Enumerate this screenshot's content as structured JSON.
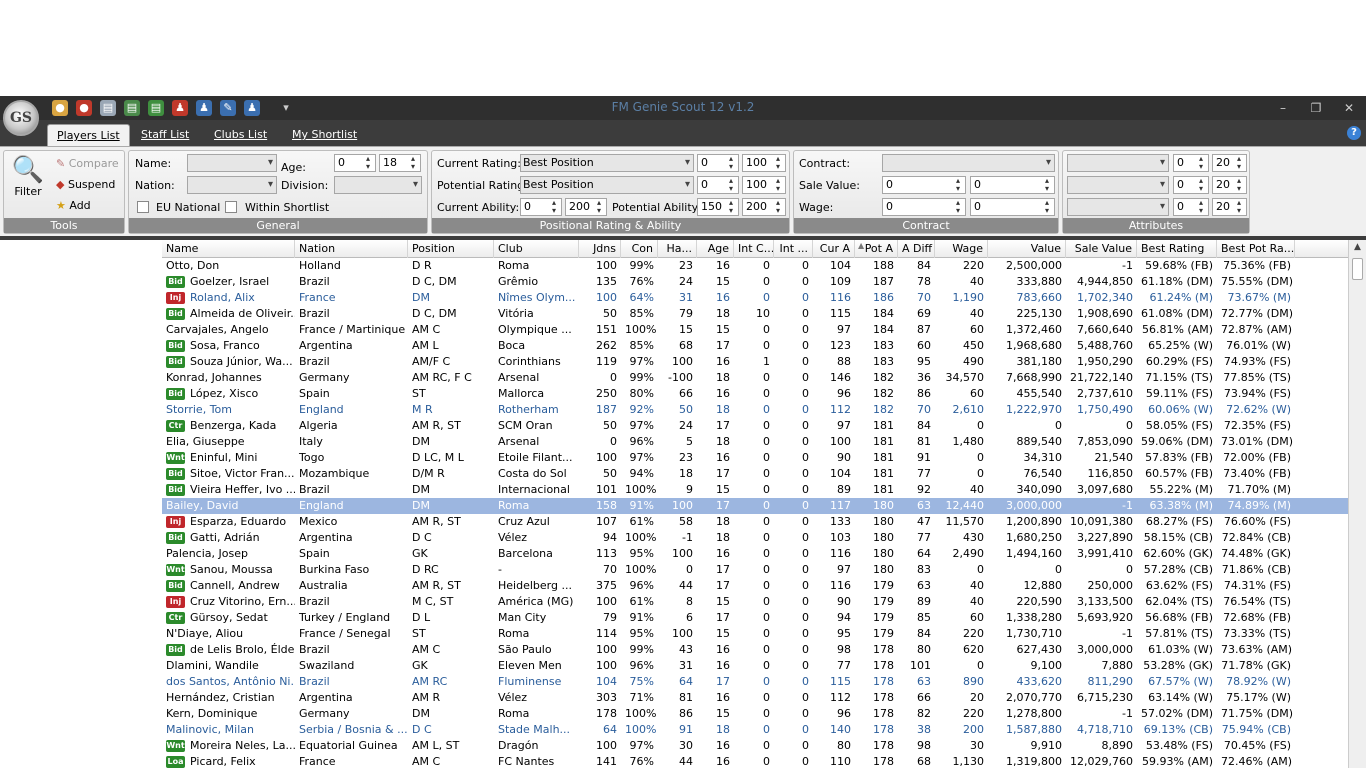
{
  "app": {
    "title": "FM Genie Scout 12 v1.2"
  },
  "tabs": [
    {
      "label": "Players List",
      "active": true
    },
    {
      "label": "Staff List"
    },
    {
      "label": "Clubs List"
    },
    {
      "label": "My Shortlist"
    }
  ],
  "tools": {
    "filter": "Filter",
    "compare": "Compare",
    "suspend": "Suspend",
    "add": "Add",
    "caption": "Tools"
  },
  "general": {
    "name_label": "Name:",
    "nation_label": "Nation:",
    "age_label": "Age:",
    "division_label": "Division:",
    "age_min": "0",
    "age_max": "18",
    "eu_national": "EU National",
    "within_shortlist": "Within Shortlist",
    "caption": "General"
  },
  "positional": {
    "current_rating_label": "Current Rating:",
    "current_rating_value": "Best Position",
    "cr_min": "0",
    "cr_max": "100",
    "potential_rating_label": "Potential Rating:",
    "potential_rating_value": "Best Position",
    "pr_min": "0",
    "pr_max": "100",
    "current_ability_label": "Current Ability:",
    "ca_min": "0",
    "ca_max": "200",
    "potential_ability_label": "Potential Ability:",
    "pa_min": "150",
    "pa_max": "200",
    "caption": "Positional Rating & Ability"
  },
  "contract": {
    "contract_label": "Contract:",
    "sale_value_label": "Sale Value:",
    "sv_min": "0",
    "sv_max": "0",
    "wage_label": "Wage:",
    "wage_min": "0",
    "wage_max": "0",
    "caption": "Contract"
  },
  "attributes": {
    "a1_min": "0",
    "a1_max": "20",
    "a2_min": "0",
    "a2_max": "20",
    "a3_min": "0",
    "a3_max": "20",
    "caption": "Attributes"
  },
  "columns": [
    "Name",
    "Nation",
    "Position",
    "Club",
    "Jdns",
    "Con",
    "Ha...",
    "Age",
    "Int C...",
    "Int ...",
    "Cur A",
    "Pot A",
    "A Diff",
    "Wage",
    "Value",
    "Sale Value",
    "Best Rating",
    "Best Pot Ra..."
  ],
  "rows": [
    [
      "",
      "Otto, Don",
      "Holland",
      "D R",
      "Roma",
      "100",
      "99%",
      "23",
      "16",
      "0",
      "0",
      "104",
      "188",
      "84",
      "220",
      "2,500,000",
      "-1",
      "59.68% (FB)",
      "75.36% (FB)"
    ],
    [
      "Bid",
      "Goelzer, Israel",
      "Brazil",
      "D C, DM",
      "Grêmio",
      "135",
      "76%",
      "24",
      "15",
      "0",
      "0",
      "109",
      "187",
      "78",
      "40",
      "333,880",
      "4,944,850",
      "61.18% (DM)",
      "75.55% (DM)"
    ],
    [
      "Inj",
      "Roland, Alix",
      "France",
      "DM",
      "Nîmes Olym...",
      "100",
      "64%",
      "31",
      "16",
      "0",
      "0",
      "116",
      "186",
      "70",
      "1,190",
      "783,660",
      "1,702,340",
      "61.24% (M)",
      "73.67% (M)"
    ],
    [
      "Bid",
      "Almeida de Oliveir...",
      "Brazil",
      "D C, DM",
      "Vitória",
      "50",
      "85%",
      "79",
      "18",
      "10",
      "0",
      "115",
      "184",
      "69",
      "40",
      "225,130",
      "1,908,690",
      "61.08% (DM)",
      "72.77% (DM)"
    ],
    [
      "",
      "Carvajales, Angelo",
      "France / Martinique",
      "AM C",
      "Olympique ...",
      "151",
      "100%",
      "15",
      "15",
      "0",
      "0",
      "97",
      "184",
      "87",
      "60",
      "1,372,460",
      "7,660,640",
      "56.81% (AM)",
      "72.87% (AM)"
    ],
    [
      "Bid",
      "Sosa, Franco",
      "Argentina",
      "AM L",
      "Boca",
      "262",
      "85%",
      "68",
      "17",
      "0",
      "0",
      "123",
      "183",
      "60",
      "450",
      "1,968,680",
      "5,488,760",
      "65.25% (W)",
      "76.01% (W)"
    ],
    [
      "Bid",
      "Souza Júnior, Wa...",
      "Brazil",
      "AM/F C",
      "Corinthians",
      "119",
      "97%",
      "100",
      "16",
      "1",
      "0",
      "88",
      "183",
      "95",
      "490",
      "381,180",
      "1,950,290",
      "60.29% (FS)",
      "74.93% (FS)"
    ],
    [
      "",
      "Konrad, Johannes",
      "Germany",
      "AM RC, F C",
      "Arsenal",
      "0",
      "99%",
      "-100",
      "18",
      "0",
      "0",
      "146",
      "182",
      "36",
      "34,570",
      "7,668,990",
      "21,722,140",
      "71.15% (TS)",
      "77.85% (TS)"
    ],
    [
      "Bid",
      "López, Xisco",
      "Spain",
      "ST",
      "Mallorca",
      "250",
      "80%",
      "66",
      "16",
      "0",
      "0",
      "96",
      "182",
      "86",
      "60",
      "455,540",
      "2,737,610",
      "59.11% (FS)",
      "73.94% (FS)"
    ],
    [
      "",
      "Storrie, Tom",
      "England",
      "M R",
      "Rotherham",
      "187",
      "92%",
      "50",
      "18",
      "0",
      "0",
      "112",
      "182",
      "70",
      "2,610",
      "1,222,970",
      "1,750,490",
      "60.06% (W)",
      "72.62% (W)"
    ],
    [
      "Ctr",
      "Benzerga, Kada",
      "Algeria",
      "AM R, ST",
      "SCM Oran",
      "50",
      "97%",
      "24",
      "17",
      "0",
      "0",
      "97",
      "181",
      "84",
      "0",
      "0",
      "0",
      "58.05% (FS)",
      "72.35% (FS)"
    ],
    [
      "",
      "Elia, Giuseppe",
      "Italy",
      "DM",
      "Arsenal",
      "0",
      "96%",
      "5",
      "18",
      "0",
      "0",
      "100",
      "181",
      "81",
      "1,480",
      "889,540",
      "7,853,090",
      "59.06% (DM)",
      "73.01% (DM)"
    ],
    [
      "Wnt",
      "Eninful, Mini",
      "Togo",
      "D LC, M L",
      "Etoile Filant...",
      "100",
      "97%",
      "23",
      "16",
      "0",
      "0",
      "90",
      "181",
      "91",
      "0",
      "34,310",
      "21,540",
      "57.83% (FB)",
      "72.00% (FB)"
    ],
    [
      "Bid",
      "Sitoe, Victor Fran...",
      "Mozambique",
      "D/M R",
      "Costa do Sol",
      "50",
      "94%",
      "18",
      "17",
      "0",
      "0",
      "104",
      "181",
      "77",
      "0",
      "76,540",
      "116,850",
      "60.57% (FB)",
      "73.40% (FB)"
    ],
    [
      "Bid",
      "Vieira Heffer, Ivo ...",
      "Brazil",
      "DM",
      "Internacional",
      "101",
      "100%",
      "9",
      "15",
      "0",
      "0",
      "89",
      "181",
      "92",
      "40",
      "340,090",
      "3,097,680",
      "55.22% (M)",
      "71.70% (M)"
    ],
    [
      "",
      "Bailey, David",
      "England",
      "DM",
      "Roma",
      "158",
      "91%",
      "100",
      "17",
      "0",
      "0",
      "117",
      "180",
      "63",
      "12,440",
      "3,000,000",
      "-1",
      "63.38% (M)",
      "74.89% (M)"
    ],
    [
      "Inj",
      "Esparza, Eduardo",
      "Mexico",
      "AM R, ST",
      "Cruz Azul",
      "107",
      "61%",
      "58",
      "18",
      "0",
      "0",
      "133",
      "180",
      "47",
      "11,570",
      "1,200,890",
      "10,091,380",
      "68.27% (FS)",
      "76.60% (FS)"
    ],
    [
      "Bid",
      "Gatti, Adrián",
      "Argentina",
      "D C",
      "Vélez",
      "94",
      "100%",
      "-1",
      "18",
      "0",
      "0",
      "103",
      "180",
      "77",
      "430",
      "1,680,250",
      "3,227,890",
      "58.15% (CB)",
      "72.84% (CB)"
    ],
    [
      "",
      "Palencia, Josep",
      "Spain",
      "GK",
      "Barcelona",
      "113",
      "95%",
      "100",
      "16",
      "0",
      "0",
      "116",
      "180",
      "64",
      "2,490",
      "1,494,160",
      "3,991,410",
      "62.60% (GK)",
      "74.48% (GK)"
    ],
    [
      "Wnt",
      "Sanou, Moussa",
      "Burkina Faso",
      "D RC",
      "-",
      "70",
      "100%",
      "0",
      "17",
      "0",
      "0",
      "97",
      "180",
      "83",
      "0",
      "0",
      "0",
      "57.28% (CB)",
      "71.86% (CB)"
    ],
    [
      "Bid",
      "Cannell, Andrew",
      "Australia",
      "AM R, ST",
      "Heidelberg ...",
      "375",
      "96%",
      "44",
      "17",
      "0",
      "0",
      "116",
      "179",
      "63",
      "40",
      "12,880",
      "250,000",
      "63.62% (FS)",
      "74.31% (FS)"
    ],
    [
      "Inj",
      "Cruz Vitorino, Ern...",
      "Brazil",
      "M C, ST",
      "América (MG)",
      "100",
      "61%",
      "8",
      "15",
      "0",
      "0",
      "90",
      "179",
      "89",
      "40",
      "220,590",
      "3,133,500",
      "62.04% (TS)",
      "76.54% (TS)"
    ],
    [
      "Ctr",
      "Gürsoy, Sedat",
      "Turkey / England",
      "D L",
      "Man City",
      "79",
      "91%",
      "6",
      "17",
      "0",
      "0",
      "94",
      "179",
      "85",
      "60",
      "1,338,280",
      "5,693,920",
      "56.68% (FB)",
      "72.68% (FB)"
    ],
    [
      "",
      "N'Diaye, Aliou",
      "France / Senegal",
      "ST",
      "Roma",
      "114",
      "95%",
      "100",
      "15",
      "0",
      "0",
      "95",
      "179",
      "84",
      "220",
      "1,730,710",
      "-1",
      "57.81% (TS)",
      "73.33% (TS)"
    ],
    [
      "Bid",
      "de Lelis Brolo, Élder",
      "Brazil",
      "AM C",
      "São Paulo",
      "100",
      "99%",
      "43",
      "16",
      "0",
      "0",
      "98",
      "178",
      "80",
      "620",
      "627,430",
      "3,000,000",
      "61.03% (W)",
      "73.63% (AM)"
    ],
    [
      "",
      "Dlamini, Wandile",
      "Swaziland",
      "GK",
      "Eleven Men",
      "100",
      "96%",
      "31",
      "16",
      "0",
      "0",
      "77",
      "178",
      "101",
      "0",
      "9,100",
      "7,880",
      "53.28% (GK)",
      "71.78% (GK)"
    ],
    [
      "",
      "dos Santos, Antônio Ni...",
      "Brazil",
      "AM RC",
      "Fluminense",
      "104",
      "75%",
      "64",
      "17",
      "0",
      "0",
      "115",
      "178",
      "63",
      "890",
      "433,620",
      "811,290",
      "67.57% (W)",
      "78.92% (W)"
    ],
    [
      "",
      "Hernández, Cristian",
      "Argentina",
      "AM R",
      "Vélez",
      "303",
      "71%",
      "81",
      "16",
      "0",
      "0",
      "112",
      "178",
      "66",
      "20",
      "2,070,770",
      "6,715,230",
      "63.14% (W)",
      "75.17% (W)"
    ],
    [
      "",
      "Kern, Dominique",
      "Germany",
      "DM",
      "Roma",
      "178",
      "100%",
      "86",
      "15",
      "0",
      "0",
      "96",
      "178",
      "82",
      "220",
      "1,278,800",
      "-1",
      "57.02% (DM)",
      "71.75% (DM)"
    ],
    [
      "",
      "Malinovic, Milan",
      "Serbia / Bosnia & ...",
      "D C",
      "Stade Malh...",
      "64",
      "100%",
      "91",
      "18",
      "0",
      "0",
      "140",
      "178",
      "38",
      "200",
      "1,587,880",
      "4,718,710",
      "69.13% (CB)",
      "75.94% (CB)"
    ],
    [
      "Wnt",
      "Moreira Neles, La...",
      "Equatorial Guinea",
      "AM L, ST",
      "Dragón",
      "100",
      "97%",
      "30",
      "16",
      "0",
      "0",
      "80",
      "178",
      "98",
      "30",
      "9,910",
      "8,890",
      "53.48% (FS)",
      "70.45% (FS)"
    ],
    [
      "Loa",
      "Picard, Felix",
      "France",
      "AM C",
      "FC Nantes",
      "141",
      "76%",
      "44",
      "16",
      "0",
      "0",
      "110",
      "178",
      "68",
      "1,130",
      "1,319,800",
      "12,029,760",
      "59.93% (AM)",
      "72.46% (AM)"
    ]
  ],
  "row_styles": {
    "blue": [
      2,
      9,
      26,
      29
    ],
    "selected": 15
  }
}
